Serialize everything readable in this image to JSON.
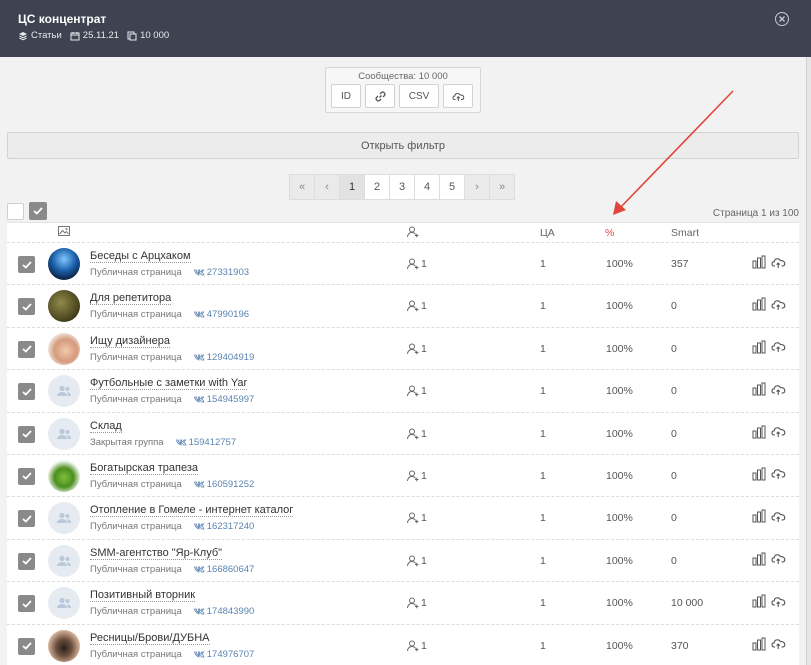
{
  "header": {
    "title": "ЦС концентрат",
    "type_label": "Статьи",
    "date": "25.11.21",
    "count": "10 000"
  },
  "export": {
    "label": "Сообщества: 10 000",
    "id_label": "ID",
    "csv_label": "CSV"
  },
  "filter_label": "Открыть фильтр",
  "pagination": {
    "first": "«",
    "prev": "‹",
    "pages": [
      "1",
      "2",
      "3",
      "4",
      "5"
    ],
    "next": "›",
    "last": "»",
    "current": "1"
  },
  "page_info": "Страница 1 из 100",
  "columns": {
    "ca": "ЦА",
    "pct": "%",
    "smart": "Smart"
  },
  "colors": {
    "header_bg": "#3d4350",
    "pct_header": "#e04848",
    "arrow": "#e0473c",
    "id_link": "#5b84b1"
  },
  "rows": [
    {
      "name": "Беседы с Арцхаком",
      "type": "Публичная страница",
      "id": "27331903",
      "members": "1",
      "ca": "1",
      "pct": "100%",
      "smart": "357",
      "avatar": "photo-blue"
    },
    {
      "name": "Для репетитора",
      "type": "Публичная страница",
      "id": "47990196",
      "members": "1",
      "ca": "1",
      "pct": "100%",
      "smart": "0",
      "avatar": "photo-olive"
    },
    {
      "name": "Ищу дизайнера",
      "type": "Публичная страница",
      "id": "129404919",
      "members": "1",
      "ca": "1",
      "pct": "100%",
      "smart": "0",
      "avatar": "photo-hand"
    },
    {
      "name": "Футбольные с заметки with Yar",
      "type": "Публичная страница",
      "id": "154945997",
      "members": "1",
      "ca": "1",
      "pct": "100%",
      "smart": "0",
      "avatar": "placeholder"
    },
    {
      "name": "Склад",
      "type": "Закрытая группа",
      "id": "159412757",
      "members": "1",
      "ca": "1",
      "pct": "100%",
      "smart": "0",
      "avatar": "placeholder"
    },
    {
      "name": "Богатырская трапеза",
      "type": "Публичная страница",
      "id": "160591252",
      "members": "1",
      "ca": "1",
      "pct": "100%",
      "smart": "0",
      "avatar": "photo-green"
    },
    {
      "name": "Отопление в Гомеле - интернет каталог",
      "type": "Публичная страница",
      "id": "162317240",
      "members": "1",
      "ca": "1",
      "pct": "100%",
      "smart": "0",
      "avatar": "placeholder"
    },
    {
      "name": "SMM-агентство \"Яр-Клуб\"",
      "type": "Публичная страница",
      "id": "166860647",
      "members": "1",
      "ca": "1",
      "pct": "100%",
      "smart": "0",
      "avatar": "placeholder"
    },
    {
      "name": "Позитивный вторник",
      "type": "Публичная страница",
      "id": "174843990",
      "members": "1",
      "ca": "1",
      "pct": "100%",
      "smart": "10 000",
      "avatar": "placeholder"
    },
    {
      "name": "Ресницы/Брови/ДУБНА",
      "type": "Публичная страница",
      "id": "174976707",
      "members": "1",
      "ca": "1",
      "pct": "100%",
      "smart": "370",
      "avatar": "photo-eye"
    }
  ]
}
